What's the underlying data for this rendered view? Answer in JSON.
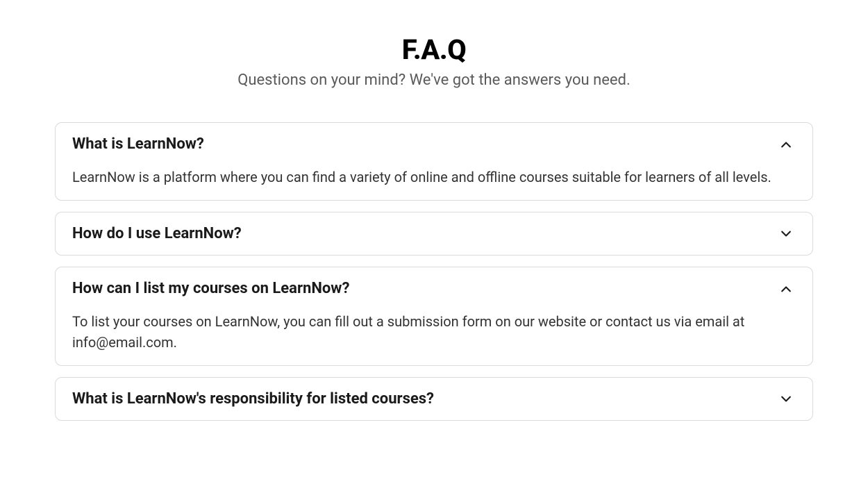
{
  "header": {
    "title": "F.A.Q",
    "subtitle": "Questions on your mind? We've got the answers you need."
  },
  "faq": {
    "items": [
      {
        "question": "What is LearnNow?",
        "answer": "LearnNow is a platform where you can find a variety of online and offline courses suitable for learners of all levels.",
        "expanded": true
      },
      {
        "question": "How do I use LearnNow?",
        "answer": "",
        "expanded": false
      },
      {
        "question": "How can I list my courses on LearnNow?",
        "answer": "To list your courses on LearnNow, you can fill out a submission form on our website or contact us via email at info@email.com.",
        "expanded": true
      },
      {
        "question": "What is LearnNow's responsibility for listed courses?",
        "answer": "",
        "expanded": false
      }
    ]
  }
}
